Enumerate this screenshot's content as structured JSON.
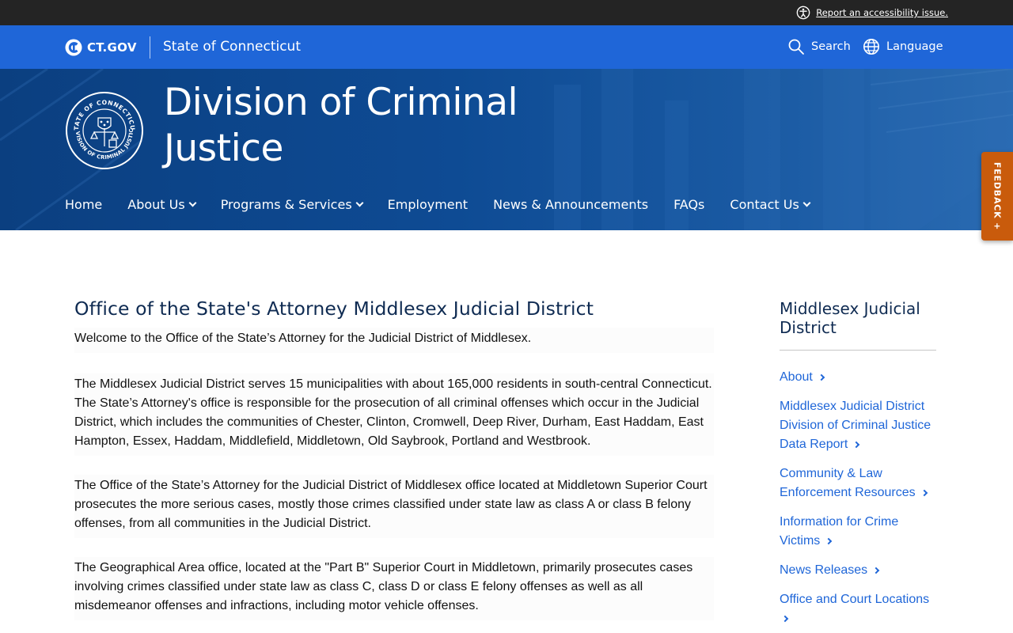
{
  "utility_bar": {
    "accessibility_link": "Report an accessibility issue."
  },
  "ctgov_header": {
    "logo_text": "CT.GOV",
    "state_name": "State of Connecticut",
    "search_label": "Search",
    "language_label": "Language"
  },
  "hero": {
    "title": "Division of Criminal Justice",
    "seal_top_text": "STATE OF CONNECTICUT",
    "seal_bottom_text": "DIVISION OF CRIMINAL JUSTICE"
  },
  "nav": {
    "items": [
      {
        "label": "Home",
        "has_dropdown": false
      },
      {
        "label": "About Us",
        "has_dropdown": true
      },
      {
        "label": "Programs & Services",
        "has_dropdown": true
      },
      {
        "label": "Employment",
        "has_dropdown": false
      },
      {
        "label": "News & Announcements",
        "has_dropdown": false
      },
      {
        "label": "FAQs",
        "has_dropdown": false
      },
      {
        "label": "Contact Us",
        "has_dropdown": true
      }
    ]
  },
  "feedback": {
    "label": "FEEDBACK +"
  },
  "main": {
    "title": "Office of the State's Attorney Middlesex Judicial District",
    "paragraphs": [
      "Welcome to the Office of the State’s Attorney for the Judicial District of Middlesex.",
      "The Middlesex Judicial District serves 15 municipalities with about 165,000 residents in south-central Connecticut. The State’s Attorney's office is responsible for the prosecution of all criminal offenses which occur in the Judicial District, which includes the communities of Chester, Clinton, Cromwell, Deep River, Durham, East Haddam, East Hampton, Essex, Haddam, Middlefield, Middletown, Old Saybrook, Portland and Westbrook.",
      "The Office of the State’s Attorney for the Judicial District of Middlesex office located at Middletown Superior Court prosecutes the more serious cases, mostly those crimes classified under state law as class A or class B felony offenses, from all communities in the Judicial District.",
      "The Geographical Area office, located at the \"Part B\" Superior Court in Middletown, primarily prosecutes cases involving crimes classified under state law as class C, class D or class E felony offenses as well as all misdemeanor offenses and infractions, including motor vehicle offenses."
    ]
  },
  "sidebar": {
    "title": "Middlesex Judicial District",
    "links": [
      "About",
      "Middlesex Judicial District Division of Criminal Justice Data Report",
      "Community & Law Enforcement Resources",
      "Information for Crime Victims",
      "News Releases",
      "Office and Court Locations"
    ]
  },
  "colors": {
    "utility_bar": "#242424",
    "ctgov_blue": "#1f66d8",
    "hero_blue": "#0d4a92",
    "feedback_orange": "#c95b0c",
    "heading_navy": "#0f2b52",
    "link_blue": "#1f66d8"
  }
}
